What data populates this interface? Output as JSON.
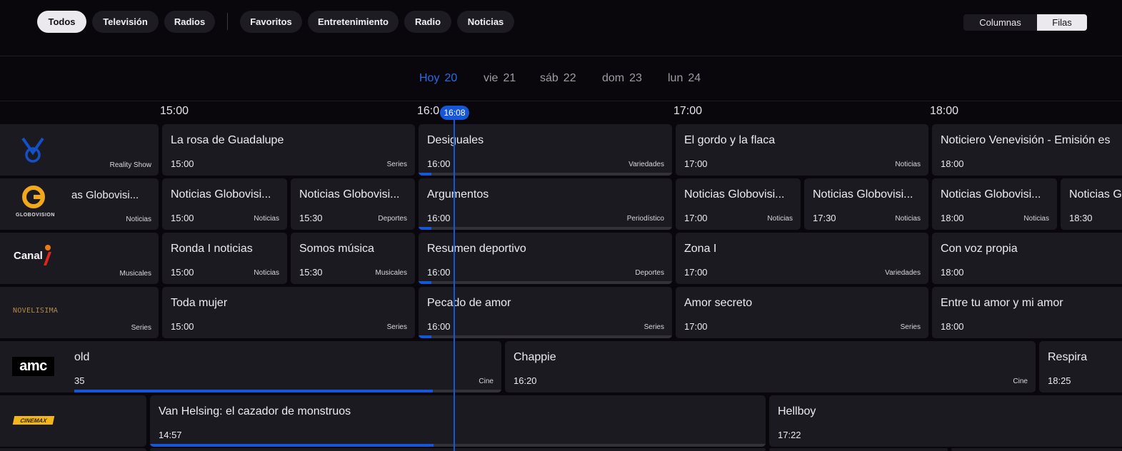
{
  "filters": {
    "chips": [
      "Todos",
      "Televisión",
      "Radios",
      "Favoritos",
      "Entretenimiento",
      "Radio",
      "Noticias"
    ],
    "active": "Todos"
  },
  "view_toggle": {
    "columns_label": "Columnas",
    "rows_label": "Filas",
    "active": "Filas"
  },
  "dates": [
    {
      "day": "Hoy",
      "num": "20",
      "active": true
    },
    {
      "day": "vie",
      "num": "21"
    },
    {
      "day": "sáb",
      "num": "22"
    },
    {
      "day": "dom",
      "num": "23"
    },
    {
      "day": "lun",
      "num": "24"
    }
  ],
  "timeline": {
    "ticks": [
      "15:00",
      "16:0",
      "17:00",
      "18:00"
    ],
    "now": "16:08"
  },
  "channels": {
    "venevision": {
      "logo_genre": "Reality Show",
      "programs": [
        {
          "title": "La rosa de Guadalupe",
          "time": "15:00",
          "genre": "Series"
        },
        {
          "title": "Desiguales",
          "time": "16:00",
          "genre": "Variedades",
          "progress": 0.05
        },
        {
          "title": "El gordo y la flaca",
          "time": "17:00",
          "genre": "Noticias"
        },
        {
          "title": "Noticiero Venevisión - Emisión es",
          "time": "18:00",
          "genre": ""
        }
      ]
    },
    "globovision": {
      "logo_text": "GLOBOVISION",
      "clip_title": "as Globovisi...",
      "logo_genre": "Noticias",
      "programs": [
        {
          "title": "Noticias Globovisi...",
          "time": "15:00",
          "genre": "Noticias"
        },
        {
          "title": "Noticias Globovisi...",
          "time": "15:30",
          "genre": "Deportes"
        },
        {
          "title": "Argumentos",
          "time": "16:00",
          "genre": "Periodístico",
          "progress": 0.05
        },
        {
          "title": "Noticias Globovisi...",
          "time": "17:00",
          "genre": "Noticias"
        },
        {
          "title": "Noticias Globovisi...",
          "time": "17:30",
          "genre": "Noticias"
        },
        {
          "title": "Noticias Globovisi...",
          "time": "18:00",
          "genre": "Noticias"
        },
        {
          "title": "Noticias G",
          "time": "18:30",
          "genre": ""
        }
      ]
    },
    "canal_i": {
      "logo_text": "Canal",
      "logo_genre": "Musicales",
      "programs": [
        {
          "title": "Ronda I noticias",
          "time": "15:00",
          "genre": "Noticias"
        },
        {
          "title": "Somos música",
          "time": "15:30",
          "genre": "Musicales"
        },
        {
          "title": "Resumen deportivo",
          "time": "16:00",
          "genre": "Deportes",
          "progress": 0.05
        },
        {
          "title": "Zona I",
          "time": "17:00",
          "genre": "Variedades"
        },
        {
          "title": "Con voz propia",
          "time": "18:00",
          "genre": ""
        }
      ]
    },
    "novelisima": {
      "logo_text": "NOVELISIMA",
      "logo_genre": "Series",
      "programs": [
        {
          "title": "Toda mujer",
          "time": "15:00",
          "genre": "Series"
        },
        {
          "title": "Pecado de amor",
          "time": "16:00",
          "genre": "Series",
          "progress": 0.05
        },
        {
          "title": "Amor secreto",
          "time": "17:00",
          "genre": "Series"
        },
        {
          "title": "Entre tu amor y mi amor",
          "time": "18:00",
          "genre": ""
        }
      ]
    },
    "amc": {
      "logo_text": "amc",
      "programs": [
        {
          "title": "old",
          "time": "35",
          "genre": "Cine",
          "progress": 0.84
        },
        {
          "title": "Chappie",
          "time": "16:20",
          "genre": "Cine"
        },
        {
          "title": "Respira",
          "time": "18:25",
          "genre": ""
        }
      ]
    },
    "cinemax": {
      "logo_text": "CINEMAX",
      "programs": [
        {
          "title": "Van Helsing: el cazador de monstruos",
          "time": "14:57",
          "genre": "",
          "progress": 0.46
        },
        {
          "title": "Hellboy",
          "time": "17:22",
          "genre": ""
        }
      ]
    }
  },
  "colors": {
    "accent": "#1557d6",
    "background": "#09070c",
    "card": "#1c1a21"
  }
}
